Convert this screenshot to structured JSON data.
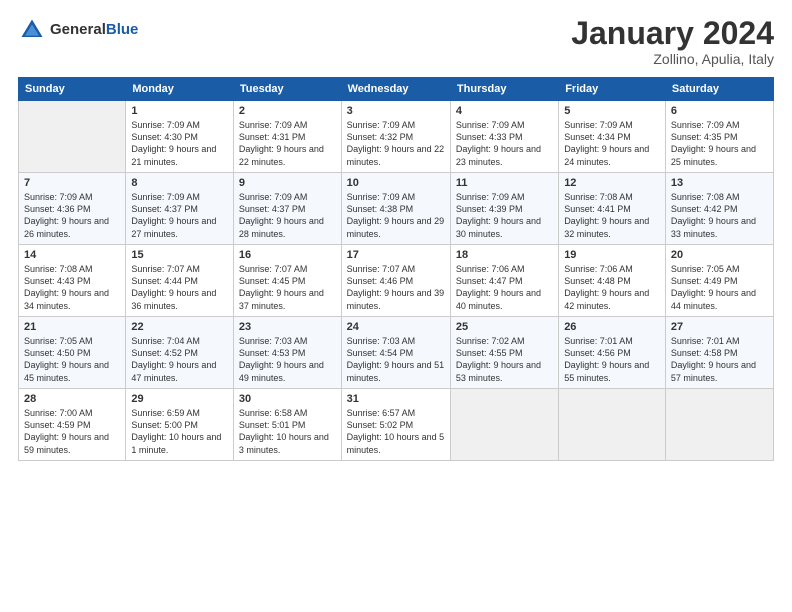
{
  "header": {
    "logo_general": "General",
    "logo_blue": "Blue",
    "title": "January 2024",
    "subtitle": "Zollino, Apulia, Italy"
  },
  "days_of_week": [
    "Sunday",
    "Monday",
    "Tuesday",
    "Wednesday",
    "Thursday",
    "Friday",
    "Saturday"
  ],
  "weeks": [
    [
      {
        "date": "",
        "sunrise": "",
        "sunset": "",
        "daylight": "",
        "empty": true
      },
      {
        "date": "1",
        "sunrise": "Sunrise: 7:09 AM",
        "sunset": "Sunset: 4:30 PM",
        "daylight": "Daylight: 9 hours and 21 minutes."
      },
      {
        "date": "2",
        "sunrise": "Sunrise: 7:09 AM",
        "sunset": "Sunset: 4:31 PM",
        "daylight": "Daylight: 9 hours and 22 minutes."
      },
      {
        "date": "3",
        "sunrise": "Sunrise: 7:09 AM",
        "sunset": "Sunset: 4:32 PM",
        "daylight": "Daylight: 9 hours and 22 minutes."
      },
      {
        "date": "4",
        "sunrise": "Sunrise: 7:09 AM",
        "sunset": "Sunset: 4:33 PM",
        "daylight": "Daylight: 9 hours and 23 minutes."
      },
      {
        "date": "5",
        "sunrise": "Sunrise: 7:09 AM",
        "sunset": "Sunset: 4:34 PM",
        "daylight": "Daylight: 9 hours and 24 minutes."
      },
      {
        "date": "6",
        "sunrise": "Sunrise: 7:09 AM",
        "sunset": "Sunset: 4:35 PM",
        "daylight": "Daylight: 9 hours and 25 minutes."
      }
    ],
    [
      {
        "date": "7",
        "sunrise": "Sunrise: 7:09 AM",
        "sunset": "Sunset: 4:36 PM",
        "daylight": "Daylight: 9 hours and 26 minutes."
      },
      {
        "date": "8",
        "sunrise": "Sunrise: 7:09 AM",
        "sunset": "Sunset: 4:37 PM",
        "daylight": "Daylight: 9 hours and 27 minutes."
      },
      {
        "date": "9",
        "sunrise": "Sunrise: 7:09 AM",
        "sunset": "Sunset: 4:37 PM",
        "daylight": "Daylight: 9 hours and 28 minutes."
      },
      {
        "date": "10",
        "sunrise": "Sunrise: 7:09 AM",
        "sunset": "Sunset: 4:38 PM",
        "daylight": "Daylight: 9 hours and 29 minutes."
      },
      {
        "date": "11",
        "sunrise": "Sunrise: 7:09 AM",
        "sunset": "Sunset: 4:39 PM",
        "daylight": "Daylight: 9 hours and 30 minutes."
      },
      {
        "date": "12",
        "sunrise": "Sunrise: 7:08 AM",
        "sunset": "Sunset: 4:41 PM",
        "daylight": "Daylight: 9 hours and 32 minutes."
      },
      {
        "date": "13",
        "sunrise": "Sunrise: 7:08 AM",
        "sunset": "Sunset: 4:42 PM",
        "daylight": "Daylight: 9 hours and 33 minutes."
      }
    ],
    [
      {
        "date": "14",
        "sunrise": "Sunrise: 7:08 AM",
        "sunset": "Sunset: 4:43 PM",
        "daylight": "Daylight: 9 hours and 34 minutes."
      },
      {
        "date": "15",
        "sunrise": "Sunrise: 7:07 AM",
        "sunset": "Sunset: 4:44 PM",
        "daylight": "Daylight: 9 hours and 36 minutes."
      },
      {
        "date": "16",
        "sunrise": "Sunrise: 7:07 AM",
        "sunset": "Sunset: 4:45 PM",
        "daylight": "Daylight: 9 hours and 37 minutes."
      },
      {
        "date": "17",
        "sunrise": "Sunrise: 7:07 AM",
        "sunset": "Sunset: 4:46 PM",
        "daylight": "Daylight: 9 hours and 39 minutes."
      },
      {
        "date": "18",
        "sunrise": "Sunrise: 7:06 AM",
        "sunset": "Sunset: 4:47 PM",
        "daylight": "Daylight: 9 hours and 40 minutes."
      },
      {
        "date": "19",
        "sunrise": "Sunrise: 7:06 AM",
        "sunset": "Sunset: 4:48 PM",
        "daylight": "Daylight: 9 hours and 42 minutes."
      },
      {
        "date": "20",
        "sunrise": "Sunrise: 7:05 AM",
        "sunset": "Sunset: 4:49 PM",
        "daylight": "Daylight: 9 hours and 44 minutes."
      }
    ],
    [
      {
        "date": "21",
        "sunrise": "Sunrise: 7:05 AM",
        "sunset": "Sunset: 4:50 PM",
        "daylight": "Daylight: 9 hours and 45 minutes."
      },
      {
        "date": "22",
        "sunrise": "Sunrise: 7:04 AM",
        "sunset": "Sunset: 4:52 PM",
        "daylight": "Daylight: 9 hours and 47 minutes."
      },
      {
        "date": "23",
        "sunrise": "Sunrise: 7:03 AM",
        "sunset": "Sunset: 4:53 PM",
        "daylight": "Daylight: 9 hours and 49 minutes."
      },
      {
        "date": "24",
        "sunrise": "Sunrise: 7:03 AM",
        "sunset": "Sunset: 4:54 PM",
        "daylight": "Daylight: 9 hours and 51 minutes."
      },
      {
        "date": "25",
        "sunrise": "Sunrise: 7:02 AM",
        "sunset": "Sunset: 4:55 PM",
        "daylight": "Daylight: 9 hours and 53 minutes."
      },
      {
        "date": "26",
        "sunrise": "Sunrise: 7:01 AM",
        "sunset": "Sunset: 4:56 PM",
        "daylight": "Daylight: 9 hours and 55 minutes."
      },
      {
        "date": "27",
        "sunrise": "Sunrise: 7:01 AM",
        "sunset": "Sunset: 4:58 PM",
        "daylight": "Daylight: 9 hours and 57 minutes."
      }
    ],
    [
      {
        "date": "28",
        "sunrise": "Sunrise: 7:00 AM",
        "sunset": "Sunset: 4:59 PM",
        "daylight": "Daylight: 9 hours and 59 minutes."
      },
      {
        "date": "29",
        "sunrise": "Sunrise: 6:59 AM",
        "sunset": "Sunset: 5:00 PM",
        "daylight": "Daylight: 10 hours and 1 minute."
      },
      {
        "date": "30",
        "sunrise": "Sunrise: 6:58 AM",
        "sunset": "Sunset: 5:01 PM",
        "daylight": "Daylight: 10 hours and 3 minutes."
      },
      {
        "date": "31",
        "sunrise": "Sunrise: 6:57 AM",
        "sunset": "Sunset: 5:02 PM",
        "daylight": "Daylight: 10 hours and 5 minutes."
      },
      {
        "date": "",
        "sunrise": "",
        "sunset": "",
        "daylight": "",
        "empty": true
      },
      {
        "date": "",
        "sunrise": "",
        "sunset": "",
        "daylight": "",
        "empty": true
      },
      {
        "date": "",
        "sunrise": "",
        "sunset": "",
        "daylight": "",
        "empty": true
      }
    ]
  ]
}
